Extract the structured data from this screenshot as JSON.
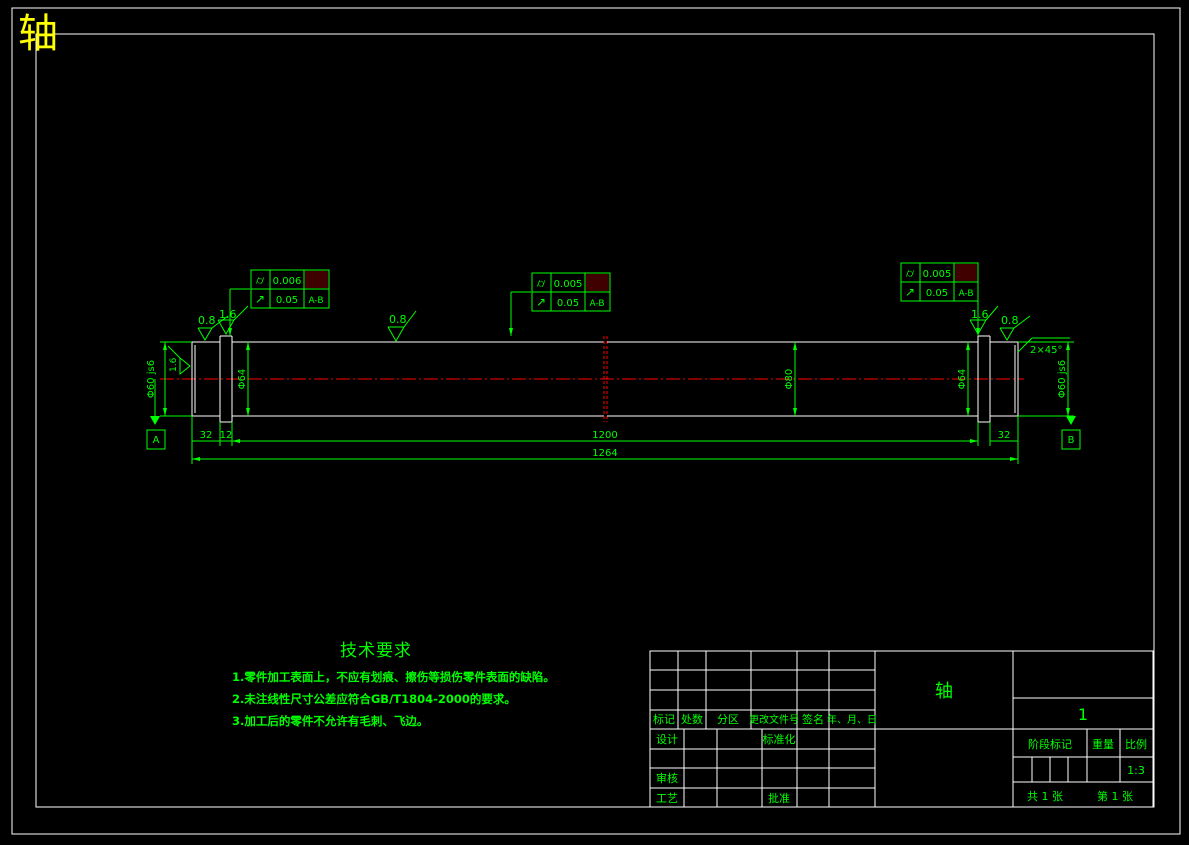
{
  "title": "轴",
  "colors": {
    "background": "#000000",
    "outline": "#ffffff",
    "dimension": "#00ff00",
    "centerline": "#ff0000",
    "title": "#ffff00",
    "datum_fill": "#400000"
  },
  "gdt": {
    "left": {
      "cylindricity": "0.006",
      "runout": "0.05",
      "datum": "A-B"
    },
    "middle": {
      "cylindricity": "0.005",
      "runout": "0.05",
      "datum": "A-B"
    },
    "right": {
      "cylindricity": "0.005",
      "runout": "0.05",
      "datum": "A-B"
    }
  },
  "roughness": {
    "left_outer": "0.8",
    "left_inner": "1.6",
    "middle": "0.8",
    "right_inner": "1.6",
    "right_outer": "0.8",
    "left_end_vertical": "1.6"
  },
  "dimensions": {
    "left_end_dia": "Φ60 js6",
    "left_shoulder_dia": "Φ64",
    "body_dia": "Φ80",
    "right_shoulder_dia": "Φ64",
    "right_end_dia": "Φ60 js6",
    "left_end_len": "32",
    "left_groove_len": "12",
    "body_len": "1200",
    "right_end_len": "32",
    "total_len": "1264",
    "chamfer": "2×45°"
  },
  "datums": {
    "a": "A",
    "b": "B"
  },
  "tech_requirements": {
    "heading": "技术要求",
    "items": [
      "1.零件加工表面上，不应有划痕、擦伤等损伤零件表面的缺陷。",
      "2.未注线性尺寸公差应符合GB/T1804-2000的要求。",
      "3.加工后的零件不允许有毛刺、飞边。"
    ]
  },
  "title_block": {
    "part_name": "轴",
    "header_row": [
      "标记",
      "处数",
      "分区",
      "更改文件号",
      "签名",
      "年、月、日"
    ],
    "design": "设计",
    "standardization": "标准化",
    "review": "审核",
    "process": "工艺",
    "approve": "批准",
    "drawing_no": "1",
    "stage_mark": "阶段标记",
    "weight": "重量",
    "scale_label": "比例",
    "scale_value": "1:3",
    "total_sheets": "共  1  张",
    "sheet_no": "第  1  张"
  }
}
